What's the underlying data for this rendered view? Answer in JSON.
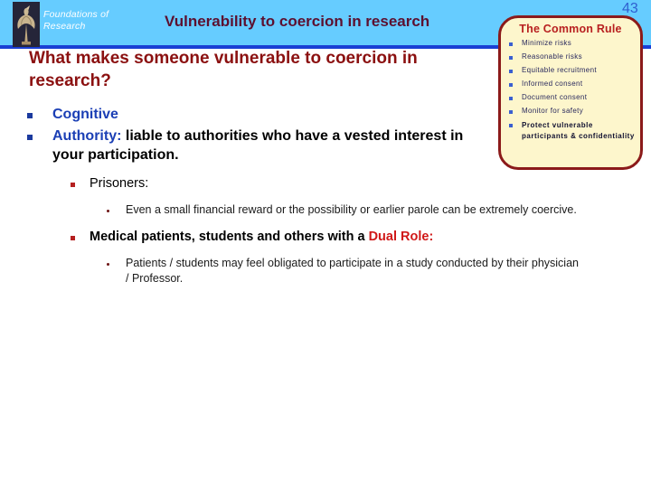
{
  "header": {
    "brand": "Foundations of Research",
    "title": "Vulnerability to coercion in research",
    "page_number": "43",
    "logo_icon": "statue-logo-icon",
    "band_color": "#66ccff",
    "rule_color": "#1a3fd4",
    "title_color": "#5c1030",
    "page_number_color": "#2f5fd0"
  },
  "callout": {
    "title": "The Common Rule",
    "title_color": "#b82020",
    "background": "#fdf6cc",
    "border_color": "#8b1a1a",
    "bullet_color": "#3a5fd0",
    "items": [
      {
        "label": "Minimize risks",
        "emphasis": false
      },
      {
        "label": "Reasonable risks",
        "emphasis": false
      },
      {
        "label": "Equitable recruitment",
        "emphasis": false
      },
      {
        "label": "Informed consent",
        "emphasis": false
      },
      {
        "label": "Document consent",
        "emphasis": false
      },
      {
        "label": "Monitor for safety",
        "emphasis": false
      },
      {
        "label": "Protect vulnerable participants & confidentiality",
        "emphasis": true
      }
    ]
  },
  "body": {
    "heading": "What makes someone vulnerable to coercion in research?",
    "heading_color": "#8b1010",
    "bullets": {
      "cognitive_label": "Cognitive",
      "authority_label": "Authority:",
      "authority_rest": "liable to authorities who have a vested interest in your participation.",
      "prisoners_label": "Prisoners:",
      "prisoners_detail": "Even a small financial reward or the possibility or earlier parole can be extremely coercive.",
      "dual_role_lead": "Medical patients, students and others with a ",
      "dual_role_accent": "Dual Role:",
      "dual_role_detail": "Patients / students may feel obligated to participate in a study conducted by their physician / Professor."
    }
  }
}
